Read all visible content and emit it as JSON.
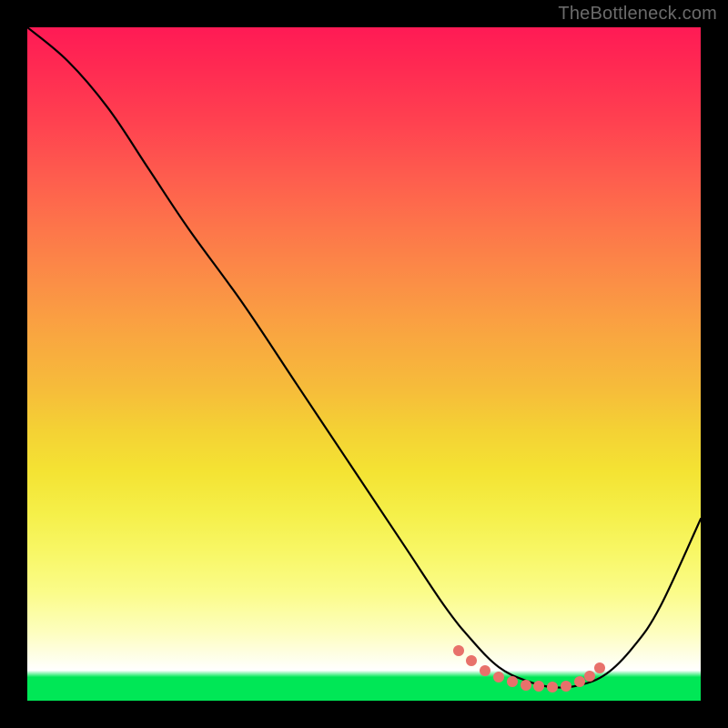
{
  "watermark": "TheBottleneck.com",
  "colors": {
    "background": "#000000",
    "gradient_top": "#ff1a55",
    "gradient_mid": "#f4e333",
    "gradient_green": "#00e756",
    "curve": "#000000",
    "dot": "#e8716b",
    "watermark": "#6b6b6b"
  },
  "chart_data": {
    "type": "line",
    "title": "",
    "xlabel": "",
    "ylabel": "",
    "xlim": [
      0,
      100
    ],
    "ylim": [
      0,
      100
    ],
    "grid": false,
    "series": [
      {
        "name": "curve",
        "x": [
          0,
          6,
          12,
          18,
          24,
          32,
          40,
          48,
          56,
          62,
          66,
          70,
          74,
          78,
          82,
          86,
          90,
          94,
          100
        ],
        "values": [
          100,
          95,
          88,
          79,
          70,
          59,
          47,
          35,
          23,
          14,
          9,
          5,
          3,
          2,
          2.3,
          4,
          8,
          14,
          27
        ]
      }
    ],
    "highlight_dots": {
      "x": [
        64,
        66,
        68,
        70,
        72,
        74,
        76,
        78,
        80,
        82,
        83.5,
        85
      ],
      "values": [
        7.5,
        6,
        4.5,
        3.5,
        2.8,
        2.3,
        2.1,
        2.0,
        2.2,
        2.8,
        3.6,
        4.8
      ]
    }
  }
}
